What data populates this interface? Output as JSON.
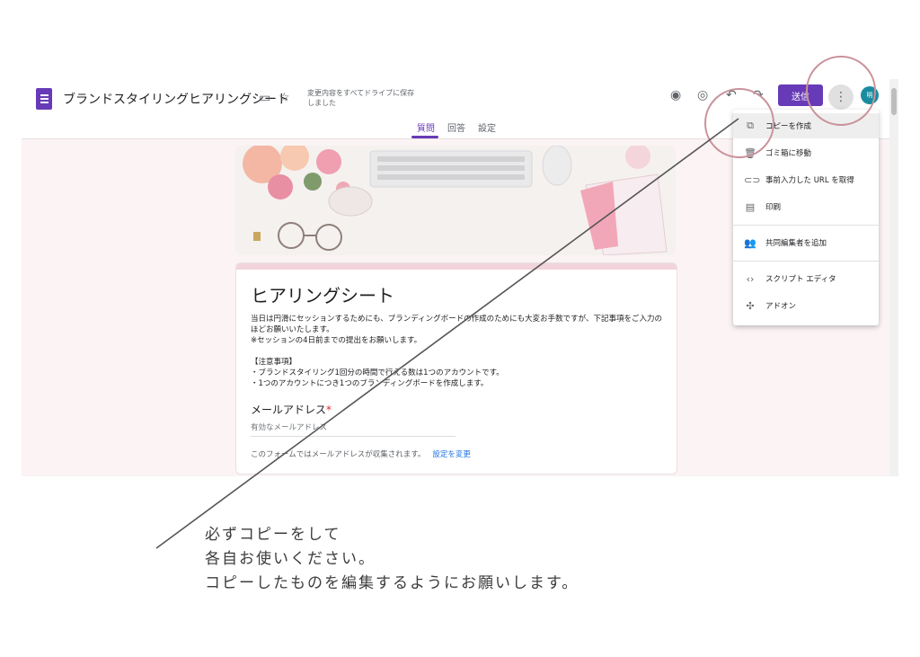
{
  "form_title": "ブランドスタイリングヒアリングシート",
  "save_status": "変更内容をすべてドライブに保存しました",
  "send_label": "送信",
  "avatar_label": "明",
  "tabs": [
    "質問",
    "回答",
    "設定"
  ],
  "card": {
    "title": "ヒアリングシート",
    "description": "当日は円滑にセッションするためにも、ブランディングボードの作成のためにも大変お手数ですが、下記事項をご入力のほどお願いいたします。\n※セッションの4日前までの提出をお願いします。\n\n【注意事項】\n・ブランドスタイリング1回分の時間で行える数は1つのアカウントです。\n・1つのアカウントにつき1つのブランディングボードを作成します。",
    "question_label": "メールアドレス",
    "required_mark": "*",
    "input_placeholder": "有効なメールアドレス",
    "collect_note": "このフォームではメールアドレスが収集されます。",
    "change_settings": "設定を変更"
  },
  "menu": {
    "items": [
      {
        "label": "コピーを作成",
        "icon": "copy-icon"
      },
      {
        "label": "ゴミ箱に移動",
        "icon": "trash-icon"
      },
      {
        "label": "事前入力した URL を取得",
        "icon": "link-icon"
      },
      {
        "label": "印刷",
        "icon": "print-icon"
      },
      {
        "label": "共同編集者を追加",
        "icon": "add-people-icon"
      },
      {
        "label": "スクリプト エディタ",
        "icon": "code-icon"
      },
      {
        "label": "アドオン",
        "icon": "puzzle-icon"
      }
    ]
  },
  "caption": {
    "line1": "必ずコピーをして",
    "line2": "各自お使いください。",
    "line3": "コピーしたものを編集するようにお願いします。"
  },
  "colors": {
    "primary": "#673ab7",
    "annotation": "#c9929a",
    "background": "#fbf3f4"
  }
}
